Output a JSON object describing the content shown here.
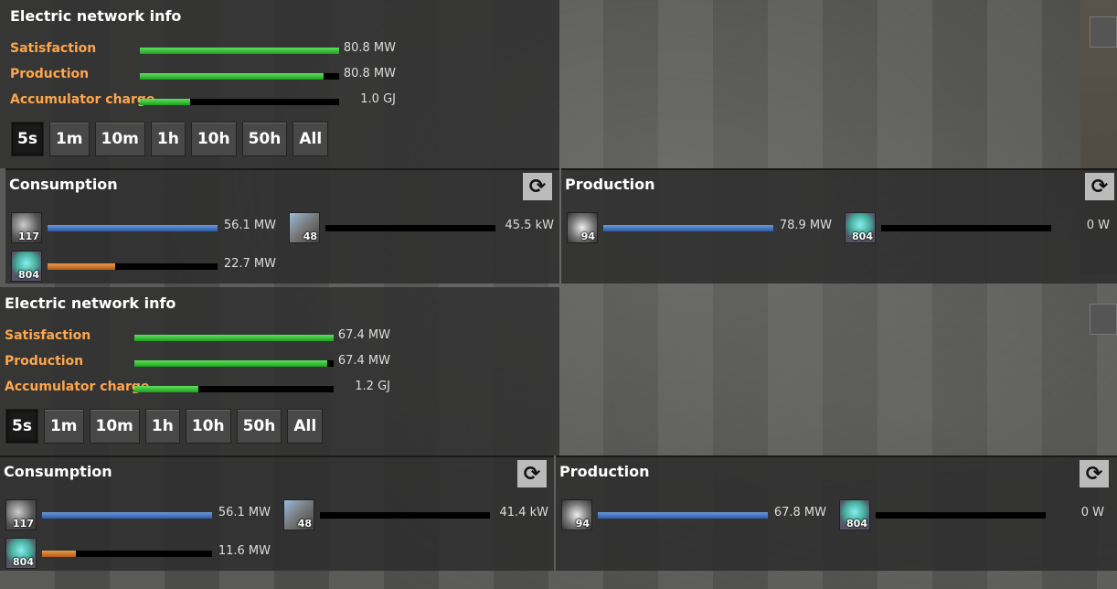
{
  "panels": [
    {
      "title": "Electric network info",
      "stats": [
        {
          "label": "Satisfaction",
          "value": "80.8 MW",
          "fill": 1.0
        },
        {
          "label": "Production",
          "value": "80.8 MW",
          "fill": 0.92
        },
        {
          "label": "Accumulator charge",
          "value": "1.0 GJ",
          "fill": 0.25
        }
      ],
      "time_buttons": [
        "5s",
        "1m",
        "10m",
        "1h",
        "10h",
        "50h",
        "All"
      ],
      "active_time": "5s",
      "consumption": {
        "title": "Consumption",
        "entries": [
          {
            "icon": "assembling-machine-icon",
            "count": "117",
            "value": "56.1 MW",
            "fill": 1.0,
            "color": "blue"
          },
          {
            "icon": "inserter-icon",
            "count": "48",
            "value": "45.5 kW",
            "fill": 0.0,
            "color": "blue"
          },
          {
            "icon": "beacon-icon",
            "count": "804",
            "value": "22.7 MW",
            "fill": 0.4,
            "color": "orange"
          }
        ]
      },
      "production": {
        "title": "Production",
        "entries": [
          {
            "icon": "steam-engine-icon",
            "count": "94",
            "value": "78.9 MW",
            "fill": 1.0,
            "color": "blue"
          },
          {
            "icon": "beacon-icon",
            "count": "804",
            "value": "0 W",
            "fill": 0.0,
            "color": "blue"
          }
        ]
      }
    },
    {
      "title": "Electric network info",
      "stats": [
        {
          "label": "Satisfaction",
          "value": "67.4 MW",
          "fill": 1.0
        },
        {
          "label": "Production",
          "value": "67.4 MW",
          "fill": 0.97
        },
        {
          "label": "Accumulator charge",
          "value": "1.2 GJ",
          "fill": 0.32
        }
      ],
      "time_buttons": [
        "5s",
        "1m",
        "10m",
        "1h",
        "10h",
        "50h",
        "All"
      ],
      "active_time": "5s",
      "consumption": {
        "title": "Consumption",
        "entries": [
          {
            "icon": "assembling-machine-icon",
            "count": "117",
            "value": "56.1 MW",
            "fill": 1.0,
            "color": "blue"
          },
          {
            "icon": "inserter-icon",
            "count": "48",
            "value": "41.4 kW",
            "fill": 0.0,
            "color": "blue"
          },
          {
            "icon": "beacon-icon",
            "count": "804",
            "value": "11.6 MW",
            "fill": 0.2,
            "color": "orange"
          }
        ]
      },
      "production": {
        "title": "Production",
        "entries": [
          {
            "icon": "steam-engine-icon",
            "count": "94",
            "value": "67.8 MW",
            "fill": 1.0,
            "color": "blue"
          },
          {
            "icon": "beacon-icon",
            "count": "804",
            "value": "0 W",
            "fill": 0.0,
            "color": "blue"
          }
        ]
      }
    }
  ],
  "refresh_icon": "refresh-icon"
}
